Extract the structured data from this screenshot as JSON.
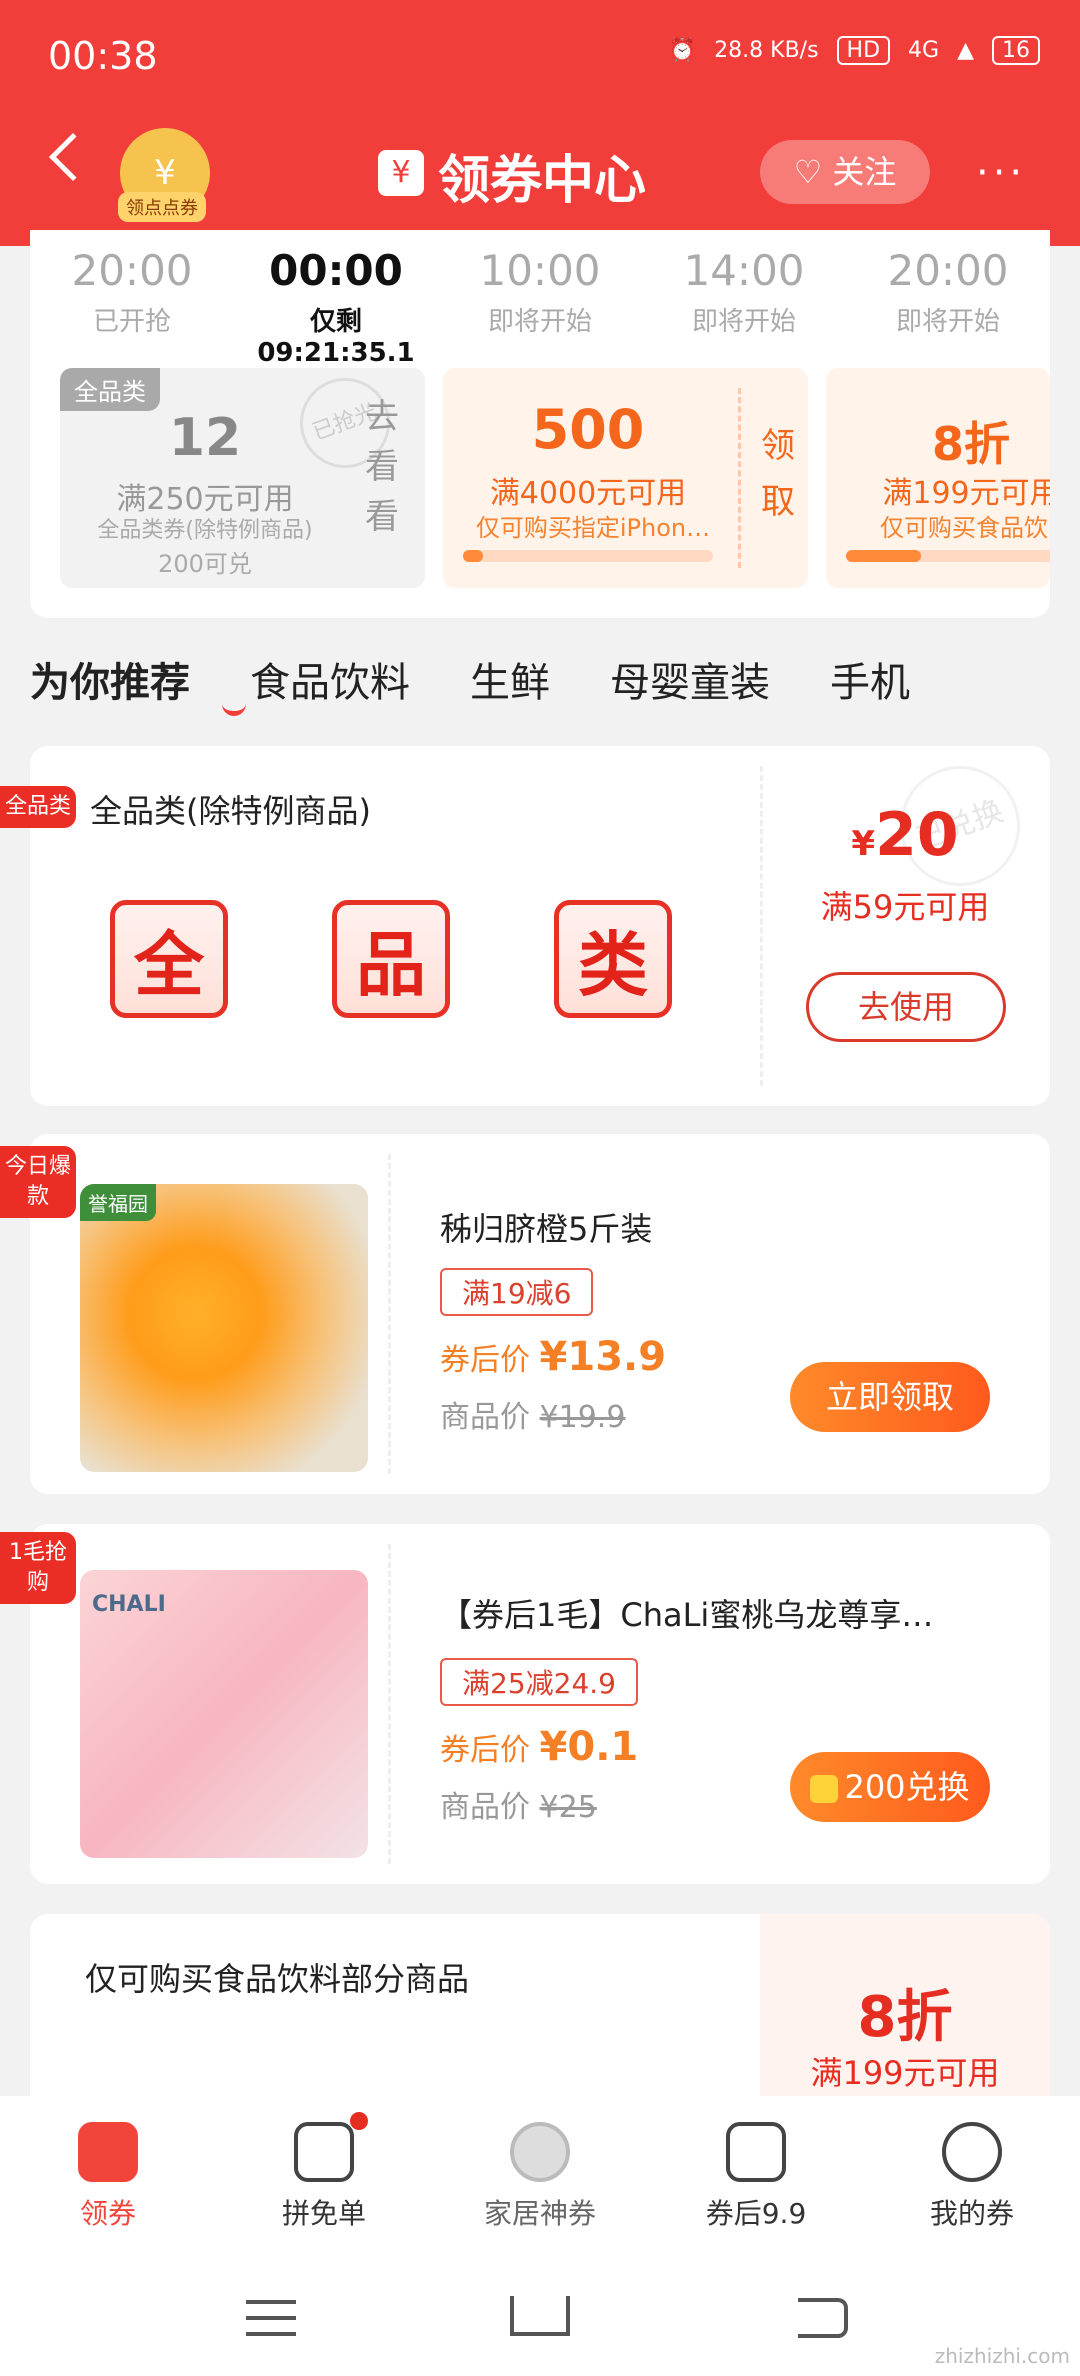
{
  "status": {
    "time": "00:38",
    "speed": "28.8 KB/s",
    "hd": "HD",
    "net": "4G",
    "battery": "16"
  },
  "header": {
    "badge_label": "领点点券",
    "title": "领券中心",
    "follow": "关注",
    "more": "···"
  },
  "sessions": [
    {
      "time": "20:00",
      "status": "已开抢"
    },
    {
      "time": "00:00",
      "status": "仅剩09:21:35.1"
    },
    {
      "time": "10:00",
      "status": "即将开始"
    },
    {
      "time": "14:00",
      "status": "即将开始"
    },
    {
      "time": "20:00",
      "status": "即将开始"
    }
  ],
  "top_coupons": [
    {
      "tag": "全品类",
      "value": "12",
      "condition": "满250元可用",
      "desc": "全品类券(除特例商品)",
      "points": "200可兑",
      "stamp": "已抢光",
      "action": "去看看"
    },
    {
      "value": "500",
      "condition": "满4000元可用",
      "desc": "仅可购买指定iPhon…",
      "action": "领取"
    },
    {
      "value": "8折",
      "condition": "满199元可用",
      "desc": "仅可购买食品饮…"
    }
  ],
  "tabs": [
    "为你推荐",
    "食品饮料",
    "生鲜",
    "母婴童装",
    "手机"
  ],
  "list": [
    {
      "corner": "全品类",
      "title": "全品类(除特例商品)",
      "chars": [
        "全",
        "品",
        "类"
      ],
      "amount": "20",
      "currency": "¥",
      "condition": "满59元可用",
      "button": "去使用",
      "stamp": "已兑换"
    },
    {
      "corner": "今日爆款",
      "brand": "誉福园",
      "title": "秭归脐橙5斤装",
      "tag": "满19减6",
      "after_label": "券后价",
      "after_price": "¥13.9",
      "orig_label": "商品价",
      "orig_price": "¥19.9",
      "button": "立即领取"
    },
    {
      "corner": "1毛抢购",
      "brand": "CHALI",
      "title": "【券后1毛】ChaLi蜜桃乌龙尊享…",
      "tag": "满25减24.9",
      "after_label": "券后价",
      "after_price": "¥0.1",
      "orig_label": "商品价",
      "orig_price": "¥25",
      "button": "200兑换"
    },
    {
      "title": "仅可购买食品饮料部分商品",
      "amount": "8折",
      "condition": "满199元可用"
    }
  ],
  "nav": [
    {
      "label": "领券",
      "active": true
    },
    {
      "label": "拼免单"
    },
    {
      "label": "家居神券"
    },
    {
      "label": "券后9.9"
    },
    {
      "label": "我的券"
    }
  ],
  "watermark": "zhizhizhi.com"
}
